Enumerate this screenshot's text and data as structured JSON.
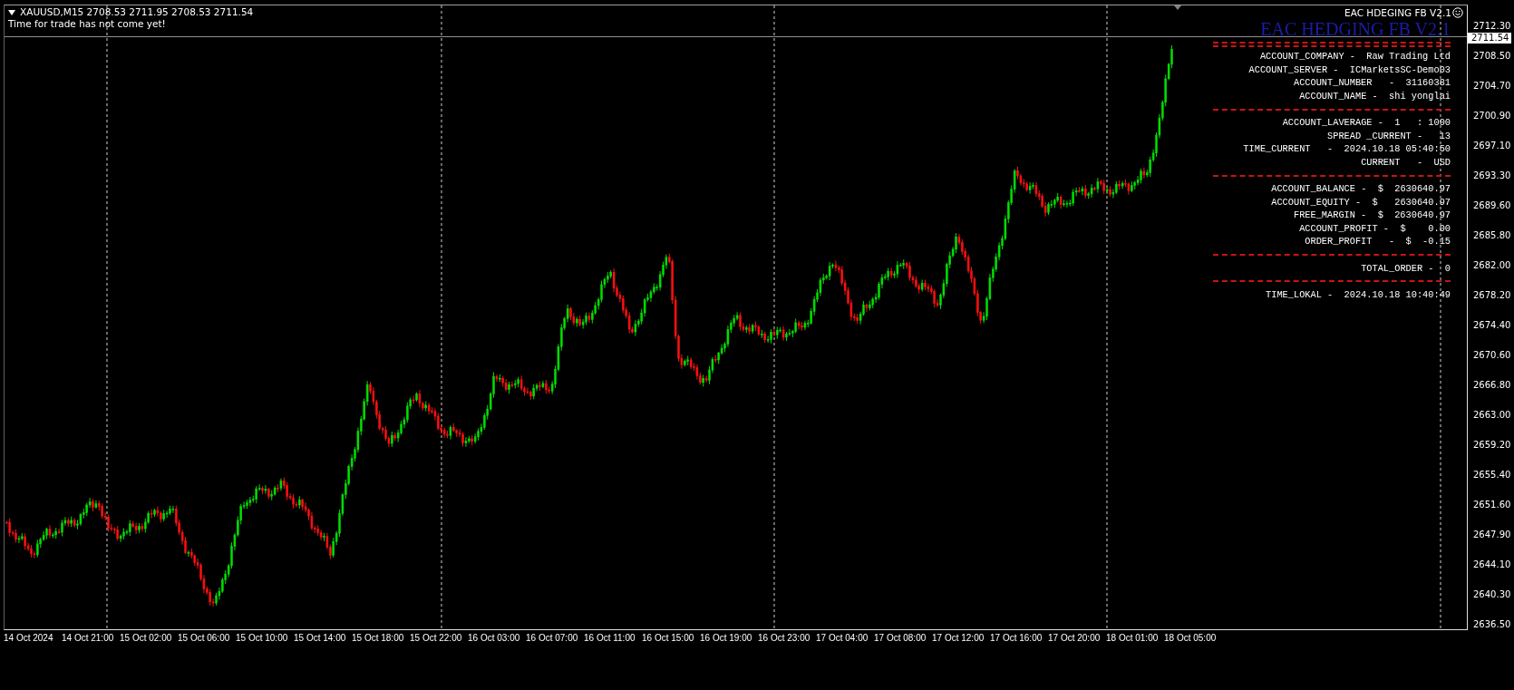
{
  "chart_header": {
    "symbol_line": "XAUUSD,M15  2708.53 2711.95 2708.53 2711.54",
    "message": "Time for trade has not come yet!"
  },
  "expert": {
    "name": "EAC HDEGING FB V2.1",
    "banner": "EAC HEDGING FB V2.1"
  },
  "info_panel": [
    {
      "kind": "double_divider"
    },
    {
      "kind": "row",
      "text": "ACCOUNT_COMPANY -  Raw Trading Ltd"
    },
    {
      "kind": "row",
      "text": "ACCOUNT_SERVER -  ICMarketsSC-Demo03"
    },
    {
      "kind": "row",
      "text": "ACCOUNT_NUMBER   -  31160381"
    },
    {
      "kind": "row",
      "text": "ACCOUNT_NAME -  shi yonglai"
    },
    {
      "kind": "divider"
    },
    {
      "kind": "row",
      "text": "ACCOUNT_LAVERAGE -  1   : 1000"
    },
    {
      "kind": "row",
      "text": "SPREAD _CURRENT -   13"
    },
    {
      "kind": "row",
      "text": "TIME_CURRENT   -  2024.10.18 05:40:50"
    },
    {
      "kind": "row",
      "text": "CURRENT   -  USD"
    },
    {
      "kind": "divider"
    },
    {
      "kind": "row",
      "text": "ACCOUNT_BALANCE -  $  2630640.97"
    },
    {
      "kind": "row",
      "text": "ACCOUNT_EQUITY -  $   2630640.97"
    },
    {
      "kind": "row",
      "text": "FREE_MARGIN -  $  2630640.97"
    },
    {
      "kind": "row",
      "text": "ACCOUNT_PROFIT -  $    0.00"
    },
    {
      "kind": "row",
      "text": "ORDER_PROFIT   -  $  -0.15"
    },
    {
      "kind": "divider"
    },
    {
      "kind": "row",
      "text": "TOTAL_ORDER -  0"
    },
    {
      "kind": "divider"
    },
    {
      "kind": "row",
      "text": "TIME_LOKAL -  2024.10.18 10:40:49"
    }
  ],
  "price_axis": {
    "current_price": "2711.54",
    "labels": [
      "2712.30",
      "2708.50",
      "2704.70",
      "2700.90",
      "2697.10",
      "2693.30",
      "2689.60",
      "2685.80",
      "2682.00",
      "2678.20",
      "2674.40",
      "2670.60",
      "2666.80",
      "2663.00",
      "2659.20",
      "2655.40",
      "2651.60",
      "2647.90",
      "2644.10",
      "2640.30",
      "2636.50"
    ]
  },
  "time_axis": {
    "labels": [
      "14 Oct 2024",
      "14 Oct 21:00",
      "15 Oct 02:00",
      "15 Oct 06:00",
      "15 Oct 10:00",
      "15 Oct 14:00",
      "15 Oct 18:00",
      "15 Oct 22:00",
      "16 Oct 03:00",
      "16 Oct 07:00",
      "16 Oct 11:00",
      "16 Oct 15:00",
      "16 Oct 19:00",
      "16 Oct 23:00",
      "17 Oct 04:00",
      "17 Oct 08:00",
      "17 Oct 12:00",
      "17 Oct 16:00",
      "17 Oct 20:00",
      "18 Oct 01:00",
      "18 Oct 05:00"
    ]
  }
}
